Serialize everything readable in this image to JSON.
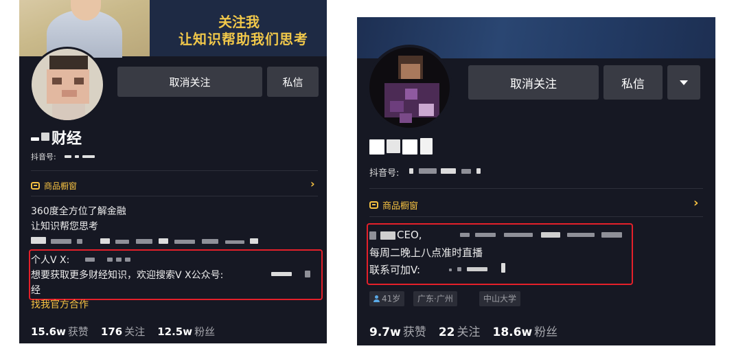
{
  "left_profile": {
    "banner": {
      "line1": "关注我",
      "line2": "让知识帮助我们思考"
    },
    "actions": {
      "unfollow": "取消关注",
      "message": "私信"
    },
    "name": "财经",
    "douyin_id_label": "抖音号:",
    "shop": {
      "label": "商品橱窗",
      "chevron": "›"
    },
    "bio": {
      "line1": "360度全方位了解金融",
      "line2": "让知识帮您思考",
      "line4": "个人V X:",
      "line5": "想要获取更多财经知识，欢迎搜索V X公众号:",
      "line6": "经"
    },
    "official_link": "找我官方合作",
    "stats": [
      {
        "value": "15.6w",
        "label": "获赞"
      },
      {
        "value": "176",
        "label": "关注"
      },
      {
        "value": "12.5w",
        "label": "粉丝"
      }
    ],
    "colors": {
      "accent": "#f7c242",
      "highlight": "#e5202a",
      "bg": "#161823"
    }
  },
  "right_profile": {
    "actions": {
      "unfollow": "取消关注",
      "message": "私信",
      "more_icon": "triangle-down-icon"
    },
    "douyin_id_label": "抖音号:",
    "shop": {
      "label": "商品橱窗",
      "chevron": "›"
    },
    "bio": {
      "line1": "CEO,",
      "line2": "每周二晚上八点准时直播",
      "line3": "联系可加V:"
    },
    "tags": {
      "age": "41岁",
      "location": "广东·广州",
      "school": "中山大学"
    },
    "stats": [
      {
        "value": "9.7w",
        "label": "获赞"
      },
      {
        "value": "22",
        "label": "关注"
      },
      {
        "value": "18.6w",
        "label": "粉丝"
      }
    ]
  }
}
